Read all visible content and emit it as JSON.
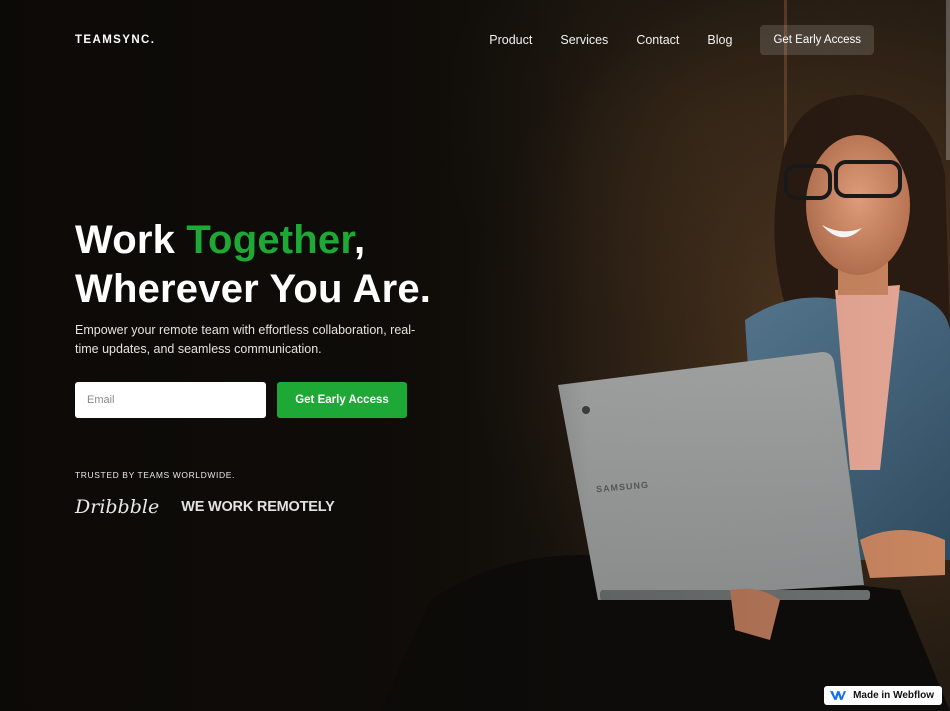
{
  "brand": {
    "logo": "TEAMSYNC."
  },
  "nav": {
    "links": [
      "Product",
      "Services",
      "Contact",
      "Blog"
    ],
    "cta": "Get Early Access"
  },
  "hero": {
    "headline_word1": "Work ",
    "headline_accent": "Together",
    "headline_comma": ",",
    "headline_line2": "Wherever You Are.",
    "subtext": "Empower your remote team with effortless collaboration, real-time updates, and seamless communication.",
    "email_placeholder": "Email",
    "cta": "Get Early Access",
    "trusted_label": "TRUSTED BY TEAMS WORLDWIDE.",
    "logos": [
      "Dribbble",
      "WE WORK REMOTELY"
    ],
    "laptop_brand": "SAMSUNG"
  },
  "badge": {
    "label": "Made in Webflow"
  },
  "colors": {
    "accent": "#1ea835",
    "background": "#15120d"
  },
  "icons": {
    "webflow": "webflow-icon"
  }
}
